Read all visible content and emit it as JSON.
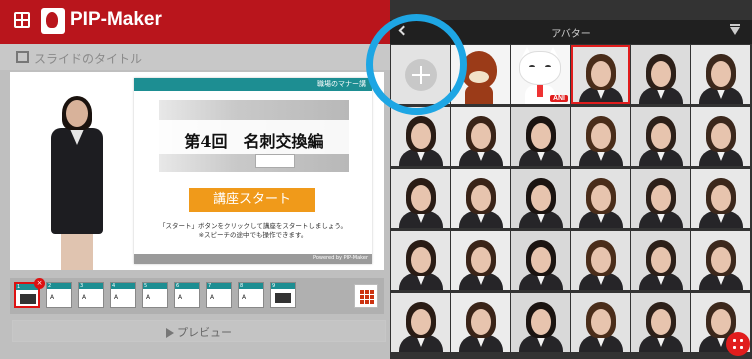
{
  "app": {
    "title": "PIP-Maker"
  },
  "editor": {
    "slide_title_placeholder": "スライドのタイトル",
    "preview_label": "プレビュー",
    "slide": {
      "header_label": "職場のマナー講",
      "hero_text": "第4回　名刺交換編",
      "start_button": "講座スタート",
      "instruction_line1": "「スタート」ボタンをクリックして講座をスタートしましょう。",
      "instruction_line2": "※スピーチの途中でも操作できます。",
      "footer_label": "Powered by PIP-Maker"
    },
    "thumbnails": [
      {
        "num": "1",
        "text": ""
      },
      {
        "num": "2",
        "text": "A"
      },
      {
        "num": "3",
        "text": "A"
      },
      {
        "num": "4",
        "text": "A"
      },
      {
        "num": "5",
        "text": "A"
      },
      {
        "num": "6",
        "text": "A"
      },
      {
        "num": "7",
        "text": "A"
      },
      {
        "num": "8",
        "text": "A"
      },
      {
        "num": "9",
        "text": ""
      }
    ]
  },
  "avatar_panel": {
    "title": "アバター",
    "add_label": "+",
    "ani_badge": "ANI",
    "avatars": [
      {
        "kind": "add"
      },
      {
        "kind": "mascot"
      },
      {
        "kind": "cat",
        "badge": "ANI"
      },
      {
        "kind": "person",
        "selected": true
      },
      {
        "kind": "person"
      },
      {
        "kind": "person"
      },
      {
        "kind": "person"
      },
      {
        "kind": "person"
      },
      {
        "kind": "person"
      },
      {
        "kind": "person"
      },
      {
        "kind": "person"
      },
      {
        "kind": "person"
      },
      {
        "kind": "person"
      },
      {
        "kind": "person"
      },
      {
        "kind": "person"
      },
      {
        "kind": "person"
      },
      {
        "kind": "person"
      },
      {
        "kind": "person"
      },
      {
        "kind": "person"
      },
      {
        "kind": "person"
      },
      {
        "kind": "person"
      },
      {
        "kind": "person"
      },
      {
        "kind": "person"
      },
      {
        "kind": "person"
      },
      {
        "kind": "person"
      },
      {
        "kind": "person"
      },
      {
        "kind": "person"
      },
      {
        "kind": "person"
      },
      {
        "kind": "person"
      },
      {
        "kind": "person"
      }
    ]
  },
  "colors": {
    "brand_red": "#b9151c",
    "highlight_blue": "#1ea6e4",
    "selection_red": "#e11d1d",
    "slide_teal": "#1d8e92",
    "start_orange": "#f09a1a"
  }
}
